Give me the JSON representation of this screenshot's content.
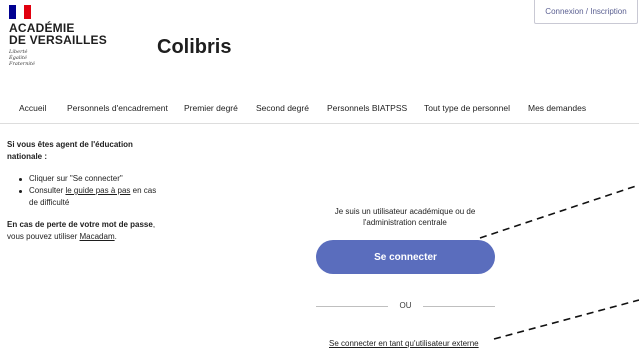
{
  "header": {
    "flag_colors": [
      "#000091",
      "#ffffff",
      "#e1000f"
    ],
    "academy_line1": "ACADÉMIE",
    "academy_line2": "DE VERSAILLES",
    "motto": [
      "Liberté",
      "Égalité",
      "Fraternité"
    ],
    "app_title": "Colibris",
    "login_label": "Connexion / Inscription"
  },
  "nav": {
    "items": [
      "Accueil",
      "Personnels d'encadrement",
      "Premier degré",
      "Second degré",
      "Personnels BIATPSS",
      "Tout type de personnel",
      "Mes demandes"
    ]
  },
  "sidebar": {
    "intro": "Si vous êtes agent de l'éducation nationale :",
    "bullet1": "Cliquer sur \"Se connecter\"",
    "bullet2_prefix": "Consulter ",
    "bullet2_link": "le guide pas à pas",
    "bullet2_suffix": " en cas de difficulté",
    "lost_bold": "En cas de perte de votre mot de passe",
    "lost_rest": ", vous pouvez utiliser ",
    "lost_link": "Macadam",
    "lost_end": "."
  },
  "main": {
    "user_text": "Je suis un utilisateur académique ou de l'administration centrale",
    "connect_label": "Se connecter",
    "or_label": "OU",
    "external_link": "Se connecter en tant qu'utilisateur externe"
  },
  "colors": {
    "button": "#5a6dbd",
    "link_accent": "#5a5f91"
  }
}
